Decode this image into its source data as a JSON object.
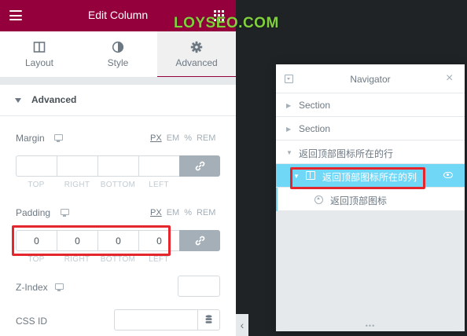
{
  "watermark": "LOYSEO.COM",
  "panel": {
    "title": "Edit Column",
    "tabs": [
      {
        "label": "Layout",
        "icon": "layout-icon"
      },
      {
        "label": "Style",
        "icon": "style-icon"
      },
      {
        "label": "Advanced",
        "icon": "gear-icon",
        "active": true
      }
    ],
    "section_title": "Advanced",
    "units": [
      "PX",
      "EM",
      "%",
      "REM"
    ],
    "active_unit": "PX",
    "dim_labels": [
      "TOP",
      "RIGHT",
      "BOTTOM",
      "LEFT"
    ],
    "margin": {
      "label": "Margin",
      "values": [
        "",
        "",
        "",
        ""
      ]
    },
    "padding": {
      "label": "Padding",
      "values": [
        "0",
        "0",
        "0",
        "0"
      ]
    },
    "zindex": {
      "label": "Z-Index",
      "value": ""
    },
    "cssid": {
      "label": "CSS ID",
      "value": ""
    }
  },
  "navigator": {
    "title": "Navigator",
    "close": "×",
    "rows": [
      {
        "label": "Section"
      },
      {
        "label": "Section"
      },
      {
        "label": "返回顶部图标所在的行"
      },
      {
        "label": "返回顶部图标所在的列",
        "selected": true
      },
      {
        "label": "返回顶部图标"
      }
    ],
    "resize_handle": "•••"
  },
  "colors": {
    "brand": "#93003c",
    "selected": "#71d7f7",
    "highlight": "#e5262c",
    "watermark": "#7fd03a"
  }
}
